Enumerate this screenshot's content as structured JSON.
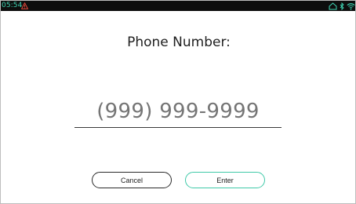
{
  "status_bar": {
    "time": "05:54",
    "icons": [
      "warning-icon",
      "home-cloud-icon",
      "bluetooth-icon",
      "wifi-icon"
    ],
    "accent_color": "#3fd6b4",
    "warning_color": "#e2493b"
  },
  "form": {
    "title": "Phone Number:",
    "phone_placeholder": "(999) 999-9999",
    "phone_value": ""
  },
  "buttons": {
    "cancel_label": "Cancel",
    "enter_label": "Enter",
    "enter_border_color": "#3fc9a8"
  }
}
